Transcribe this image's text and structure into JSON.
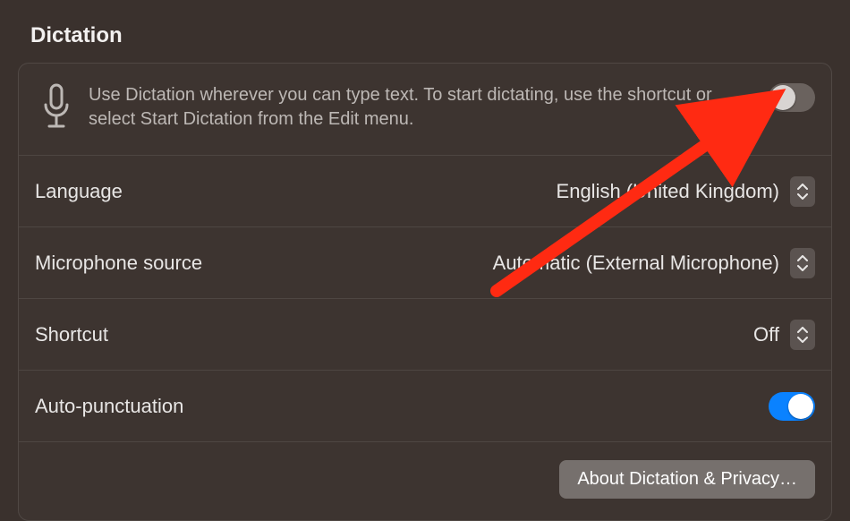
{
  "title": "Dictation",
  "intro": {
    "text": "Use Dictation wherever you can type text. To start dictating, use the shortcut or select Start Dictation from the Edit menu."
  },
  "toggles": {
    "dictation_enabled": false,
    "auto_punctuation_enabled": true
  },
  "settings": {
    "language": {
      "label": "Language",
      "value": "English (United Kingdom)"
    },
    "microphone": {
      "label": "Microphone source",
      "value": "Automatic (External Microphone)"
    },
    "shortcut": {
      "label": "Shortcut",
      "value": "Off"
    },
    "auto_punctuation": {
      "label": "Auto-punctuation"
    }
  },
  "footer": {
    "about_button": "About Dictation & Privacy…"
  }
}
